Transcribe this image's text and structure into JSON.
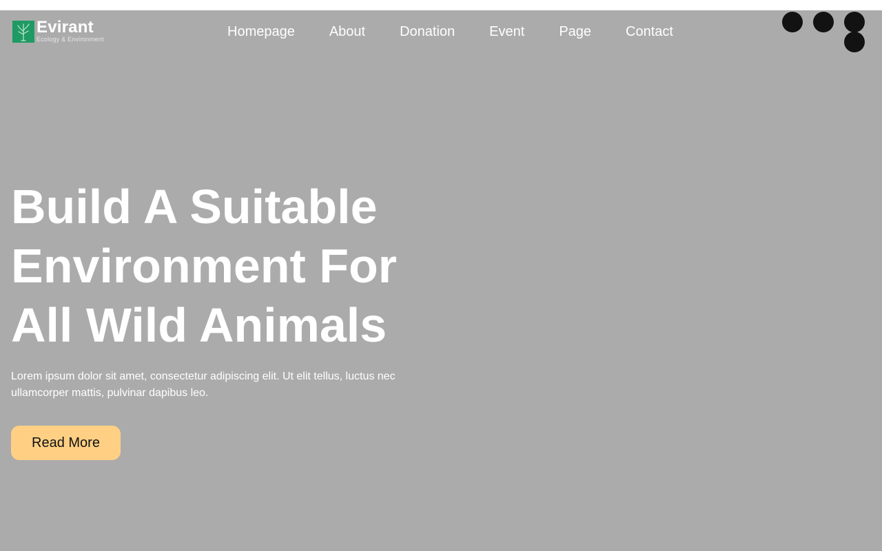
{
  "brand": {
    "name": "Evirant",
    "tagline": "Ecology & Environment",
    "accent_color": "#1f9a63",
    "logo_icon": "tree-icon"
  },
  "nav": {
    "items": [
      {
        "label": "Homepage"
      },
      {
        "label": "About"
      },
      {
        "label": "Donation"
      },
      {
        "label": "Event"
      },
      {
        "label": "Page"
      },
      {
        "label": "Contact"
      }
    ]
  },
  "header_dots": {
    "count": 4,
    "color": "#121212"
  },
  "hero": {
    "background_color": "#ababab",
    "title_lines": [
      "Build A Suitable",
      "Environment For",
      "All Wild Animals"
    ],
    "description_lines": [
      "Lorem ipsum dolor sit amet, consectetur adipiscing elit. Ut elit tellus, luctus nec",
      "ullamcorper mattis, pulvinar dapibus leo."
    ],
    "cta_label": "Read More",
    "cta_color": "#ffd084"
  }
}
